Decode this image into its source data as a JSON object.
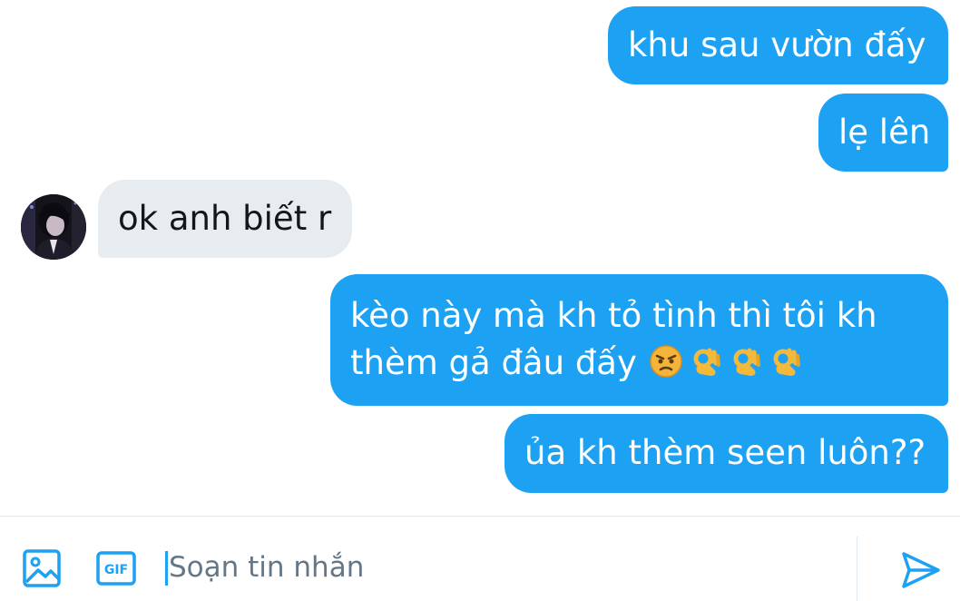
{
  "messages": [
    {
      "direction": "outgoing",
      "lines": [
        "khu sau vườn đấy"
      ]
    },
    {
      "direction": "outgoing",
      "lines": [
        "lẹ lên"
      ]
    },
    {
      "direction": "incoming",
      "lines": [
        "ok anh biết r"
      ]
    },
    {
      "direction": "outgoing",
      "lines": [
        "kèo này mà kh tỏ tình thì tôi kh",
        "thèm gả đâu đấy"
      ],
      "emojis": [
        "angry-face",
        "ok-hand",
        "ok-hand",
        "ok-hand"
      ]
    },
    {
      "direction": "outgoing",
      "lines": [
        "ủa kh thèm seen luôn??"
      ]
    }
  ],
  "composer": {
    "placeholder": "Soạn tin nhắn",
    "value": "",
    "gif_label": "GIF",
    "icons": [
      "image-icon",
      "gif-icon",
      "send-icon"
    ]
  },
  "colors": {
    "outgoing_bubble": "#1da1f2",
    "incoming_bubble": "#e6ecf0",
    "accent": "#1da1f2",
    "placeholder": "#657786"
  }
}
